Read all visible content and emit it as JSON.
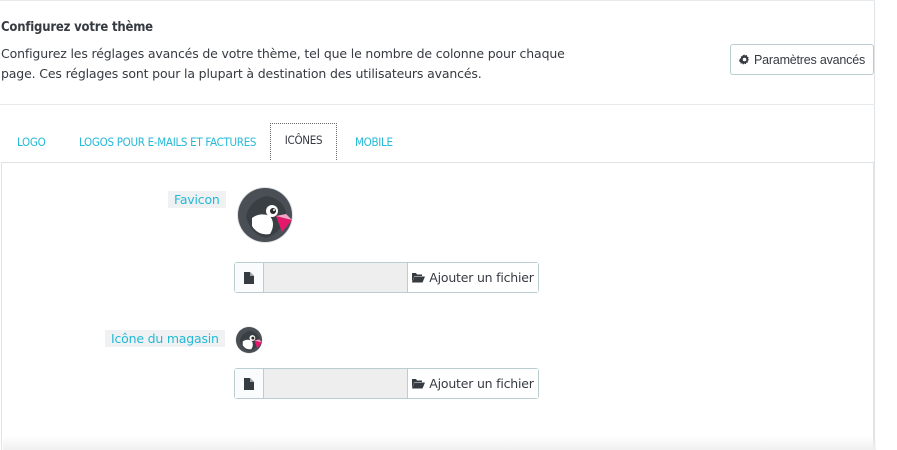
{
  "header": {
    "title": "Configurez votre thème",
    "description": "Configurez les réglages avancés de votre thème, tel que le nombre de colonne pour chaque page. Ces réglages sont pour la plupart à destination des utilisateurs avancés.",
    "advanced_button_label": "Paramètres avancés",
    "advanced_button_icon": "gear-icon"
  },
  "tabs": [
    {
      "label": "LOGO",
      "active": false
    },
    {
      "label": "LOGOS POUR E-MAILS ET FACTURES",
      "active": false
    },
    {
      "label": "ICÔNES",
      "active": true
    },
    {
      "label": "MOBILE",
      "active": false
    }
  ],
  "icons_section": {
    "favicon": {
      "label": "Favicon",
      "file_value": "",
      "add_button_label": "Ajouter un fichier",
      "file_icon": "file-icon",
      "folder_icon": "folder-open-icon"
    },
    "store_icon": {
      "label": "Icône du magasin",
      "file_value": "",
      "add_button_label": "Ajouter un fichier",
      "file_icon": "file-icon",
      "folder_icon": "folder-open-icon"
    }
  },
  "colors": {
    "accent": "#25b9d7",
    "text": "#363a41",
    "border": "#bbcdd2"
  }
}
